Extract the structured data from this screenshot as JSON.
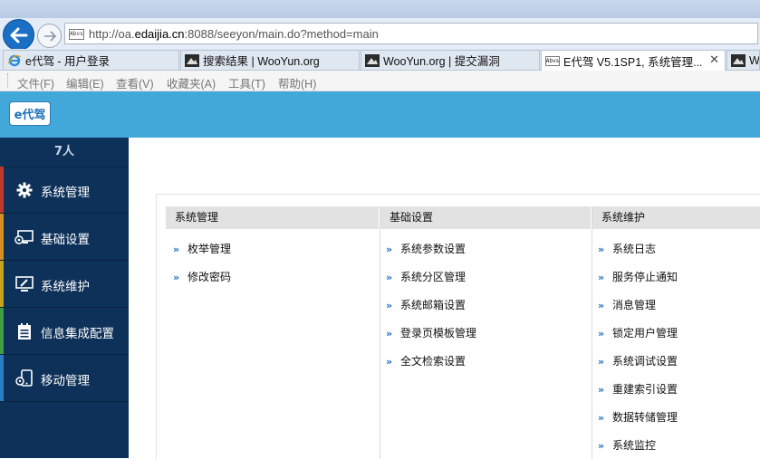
{
  "browser": {
    "url_prefix": "http://oa.",
    "url_domain": "edaijia.cn",
    "url_suffix": ":8088/seeyon/main.do?method=main",
    "favicon_text": "Abvs",
    "tabs": [
      {
        "label": "e代驾 - 用户登录",
        "icon": "ie-icon"
      },
      {
        "label": "搜索结果 | WooYun.org",
        "icon": "wooyun-icon"
      },
      {
        "label": "WooYun.org | 提交漏洞",
        "icon": "wooyun-icon"
      },
      {
        "label": "E代驾 V5.1SP1, 系统管理...",
        "icon": "seeyon-icon",
        "close": "✕"
      },
      {
        "label": "W",
        "icon": "wooyun-icon"
      }
    ],
    "menu": [
      "文件(F)",
      "编辑(E)",
      "查看(V)",
      "收藏夹(A)",
      "工具(T)",
      "帮助(H)"
    ]
  },
  "app": {
    "logo_text": "e代驾",
    "user_count": "7人",
    "nav": [
      {
        "label": "系统管理",
        "icon": "gear-icon",
        "accent": "#c0392b"
      },
      {
        "label": "基础设置",
        "icon": "monitor-settings-icon",
        "accent": "#d98c1f"
      },
      {
        "label": "系统维护",
        "icon": "monitor-edit-icon",
        "accent": "#c7a21f"
      },
      {
        "label": "信息集成配置",
        "icon": "list-icon",
        "accent": "#3f9e3f"
      },
      {
        "label": "移动管理",
        "icon": "mobile-icon",
        "accent": "#2a7fc4"
      }
    ]
  },
  "columns": [
    {
      "header": "系统管理",
      "links": [
        "枚举管理",
        "修改密码"
      ]
    },
    {
      "header": "基础设置",
      "links": [
        "系统参数设置",
        "系统分区管理",
        "系统邮箱设置",
        "登录页模板管理",
        "全文检索设置"
      ]
    },
    {
      "header": "系统维护",
      "links": [
        "系统日志",
        "服务停止通知",
        "消息管理",
        "锁定用户管理",
        "系统调试设置",
        "重建索引设置",
        "数据转储管理",
        "系统监控"
      ]
    }
  ],
  "link_arrow": "»",
  "colors": {
    "header_blue": "#42a7d9",
    "sidebar_navy": "#0d3159",
    "link_arrow": "#1e6fc4"
  }
}
